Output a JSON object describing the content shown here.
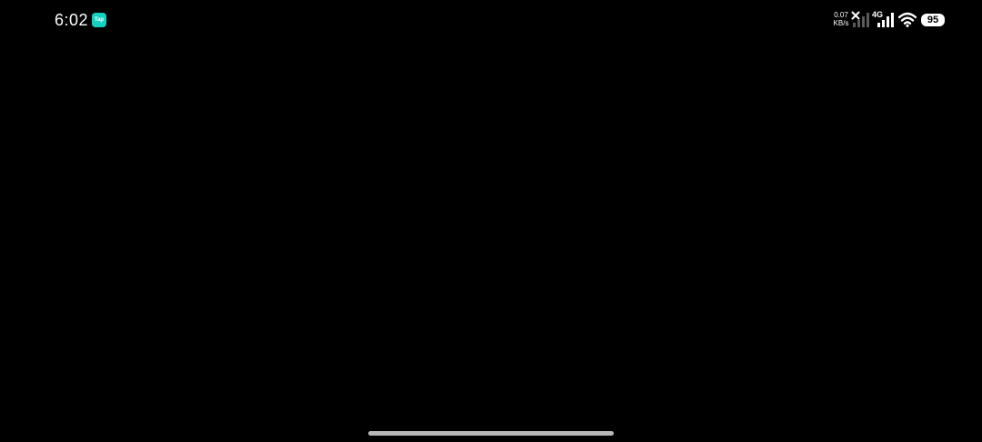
{
  "status_bar": {
    "time": "6:02",
    "app_icon_label": "Tap",
    "net_speed_value": "0.07",
    "net_speed_unit": "KB/s",
    "network_type": "4G",
    "battery_level": "95"
  },
  "colors": {
    "background": "#000000",
    "app_icon": "#15d0c0",
    "home_indicator": "#b8b8b8"
  },
  "icons": {
    "app": "taptap-app-icon",
    "no_sim": "x-icon",
    "signal_empty": "signal-empty-icon",
    "signal_full": "signal-full-icon",
    "wifi": "wifi-icon",
    "battery": "battery-icon"
  }
}
